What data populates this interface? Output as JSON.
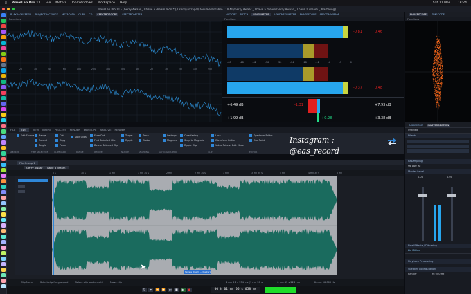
{
  "menubar": {
    "app": "WaveLab Pro 11",
    "items": [
      "File",
      "Meters",
      "Tool Windows",
      "Workspace",
      "Help"
    ],
    "right": [
      "Sat 11 Mar",
      "18:24"
    ]
  },
  "window": {
    "title": "WaveLab Pro 11 - [Gerry Awaar _ I have a dream.mon * [/Users/justragel/Documents/DATA CLIENT/Gerry Awaar _ I have a dream/Gerry Awaar _ I have a dream _ Mastering]"
  },
  "meter_tabs": [
    "PLAYBACKSPEED",
    "PROJECTRACKINGS",
    "METADATA",
    "CLIPS",
    "CD",
    "SPECTROSCOPE",
    "SPECTROMETER"
  ],
  "meter_tabs_mid": [
    "HISTORY",
    "BATCH",
    "LEVELMETER",
    "LOUDNESSMETER",
    "PHASESCOPE",
    "SPECTROGRAM"
  ],
  "meter_tabs_right": [
    "PHASESCOPE",
    "TIMECODE"
  ],
  "functions_label": "Functions",
  "spectrum": {
    "x_ticks": [
      "20",
      "30",
      "40",
      "60",
      "100",
      "200",
      "300",
      "500",
      "1k",
      "2k",
      "3k",
      "5k",
      "10k",
      "20k"
    ]
  },
  "levelmeter": {
    "peaks": [
      "-0.81",
      "-0.37"
    ],
    "peak_marks": [
      "0.46",
      "0.48"
    ],
    "rms": [
      "+6.49 dB",
      "+1.99 dB"
    ],
    "rms_right": [
      "+7.93 dB",
      "+3.38 dB"
    ],
    "balance_left": "-1.31",
    "balance_value": "+0.28",
    "scale": [
      "-60",
      "-48",
      "-42",
      "-36",
      "-30",
      "-24",
      "-18",
      "-12",
      "-6",
      "-3",
      "0"
    ],
    "fill_levels": [
      0.93,
      0.95
    ]
  },
  "ribbon": {
    "tabs": [
      "FILE",
      "EDIT",
      "VIEW",
      "INSERT",
      "PROCESS",
      "RENDER",
      "ENVELOPE",
      "ANALYZE",
      "RENDER"
    ],
    "active_tab": "EDIT",
    "groups": [
      "SPEAKER",
      "TIME SELECTION",
      "CLIPBOARD",
      "RANGE",
      "REMOVE",
      "NUDGE",
      "SNAPPING",
      "AUTO-GROUPING",
      "CLIP",
      "EDITOR"
    ],
    "buttons": [
      "Edit Source",
      "Range",
      "Extend",
      "Toggle",
      "Cut",
      "Copy",
      "Paste",
      "Split Clips",
      "Fade Out",
      "First Selected Clip",
      "Delete Selected Clip",
      "Target",
      "Ripple",
      "Track",
      "Global",
      "Settings",
      "Magnets",
      "Crossfading",
      "Snap to Magnets",
      "Ripple Clip",
      "Lock",
      "Video Follows Edit Mode",
      "Waveform Editor",
      "Spectrum Editor",
      "Cue Point"
    ]
  },
  "watermark": "Instagram :",
  "watermark_handle": "@eas_record",
  "file_tabs": {
    "group": "File Group 1",
    "doc": "Gerry Awaar _ I have a dream"
  },
  "timeline": {
    "ticks": [
      "0 s",
      "30 s",
      "1 mn",
      "1 mn 30 s",
      "2 mn",
      "2 mn 30 s",
      "3 mn",
      "3 mn 30 s",
      "4 mn",
      "4 mn 30 s",
      "5 mn"
    ],
    "clip_label": "I have a dream — Mastering"
  },
  "inspector": {
    "tabs": [
      "INSPECTOR",
      "MASTERSECTION"
    ],
    "preset": "Untitled",
    "sections": [
      "Effects",
      "Resampling",
      "Master Level",
      "Final Effects / Dithering",
      "Playback Processing",
      "Speaker Configuration"
    ],
    "resample_value": "96 000 Hz",
    "dither": "Lin Dither",
    "master_level_values": [
      "0.00",
      "0.00"
    ],
    "master_scale": [
      "-6",
      "-12",
      "-18",
      "-24",
      "-30",
      "-36",
      "-42",
      "-48",
      "-54",
      "-60"
    ],
    "master_fill": [
      0.45,
      0.45
    ],
    "render_label": "Render",
    "samplerate": "96 000 Hz"
  },
  "status": {
    "items": [
      "Clip Menu",
      "Select clip for grouped",
      "Select clip underneath",
      "Move clip"
    ],
    "time_display": "00 h 01 mn 06 s 058 ms",
    "position": "4 mn 21 s 134 ms (1 mn 37 s)",
    "sel_info": "0 mn 49 s 226 ms",
    "rate": "Stereo 96 000 Hz"
  },
  "colors": {
    "waveform": "#1a6b5e",
    "bg_wave": "#a9acb1",
    "meter_blue": "#27a6ee",
    "meter_yellow": "#c8d640",
    "meter_red": "#e02020",
    "phase_orange": "#ff6a1a",
    "accent": "#2f87d8"
  }
}
